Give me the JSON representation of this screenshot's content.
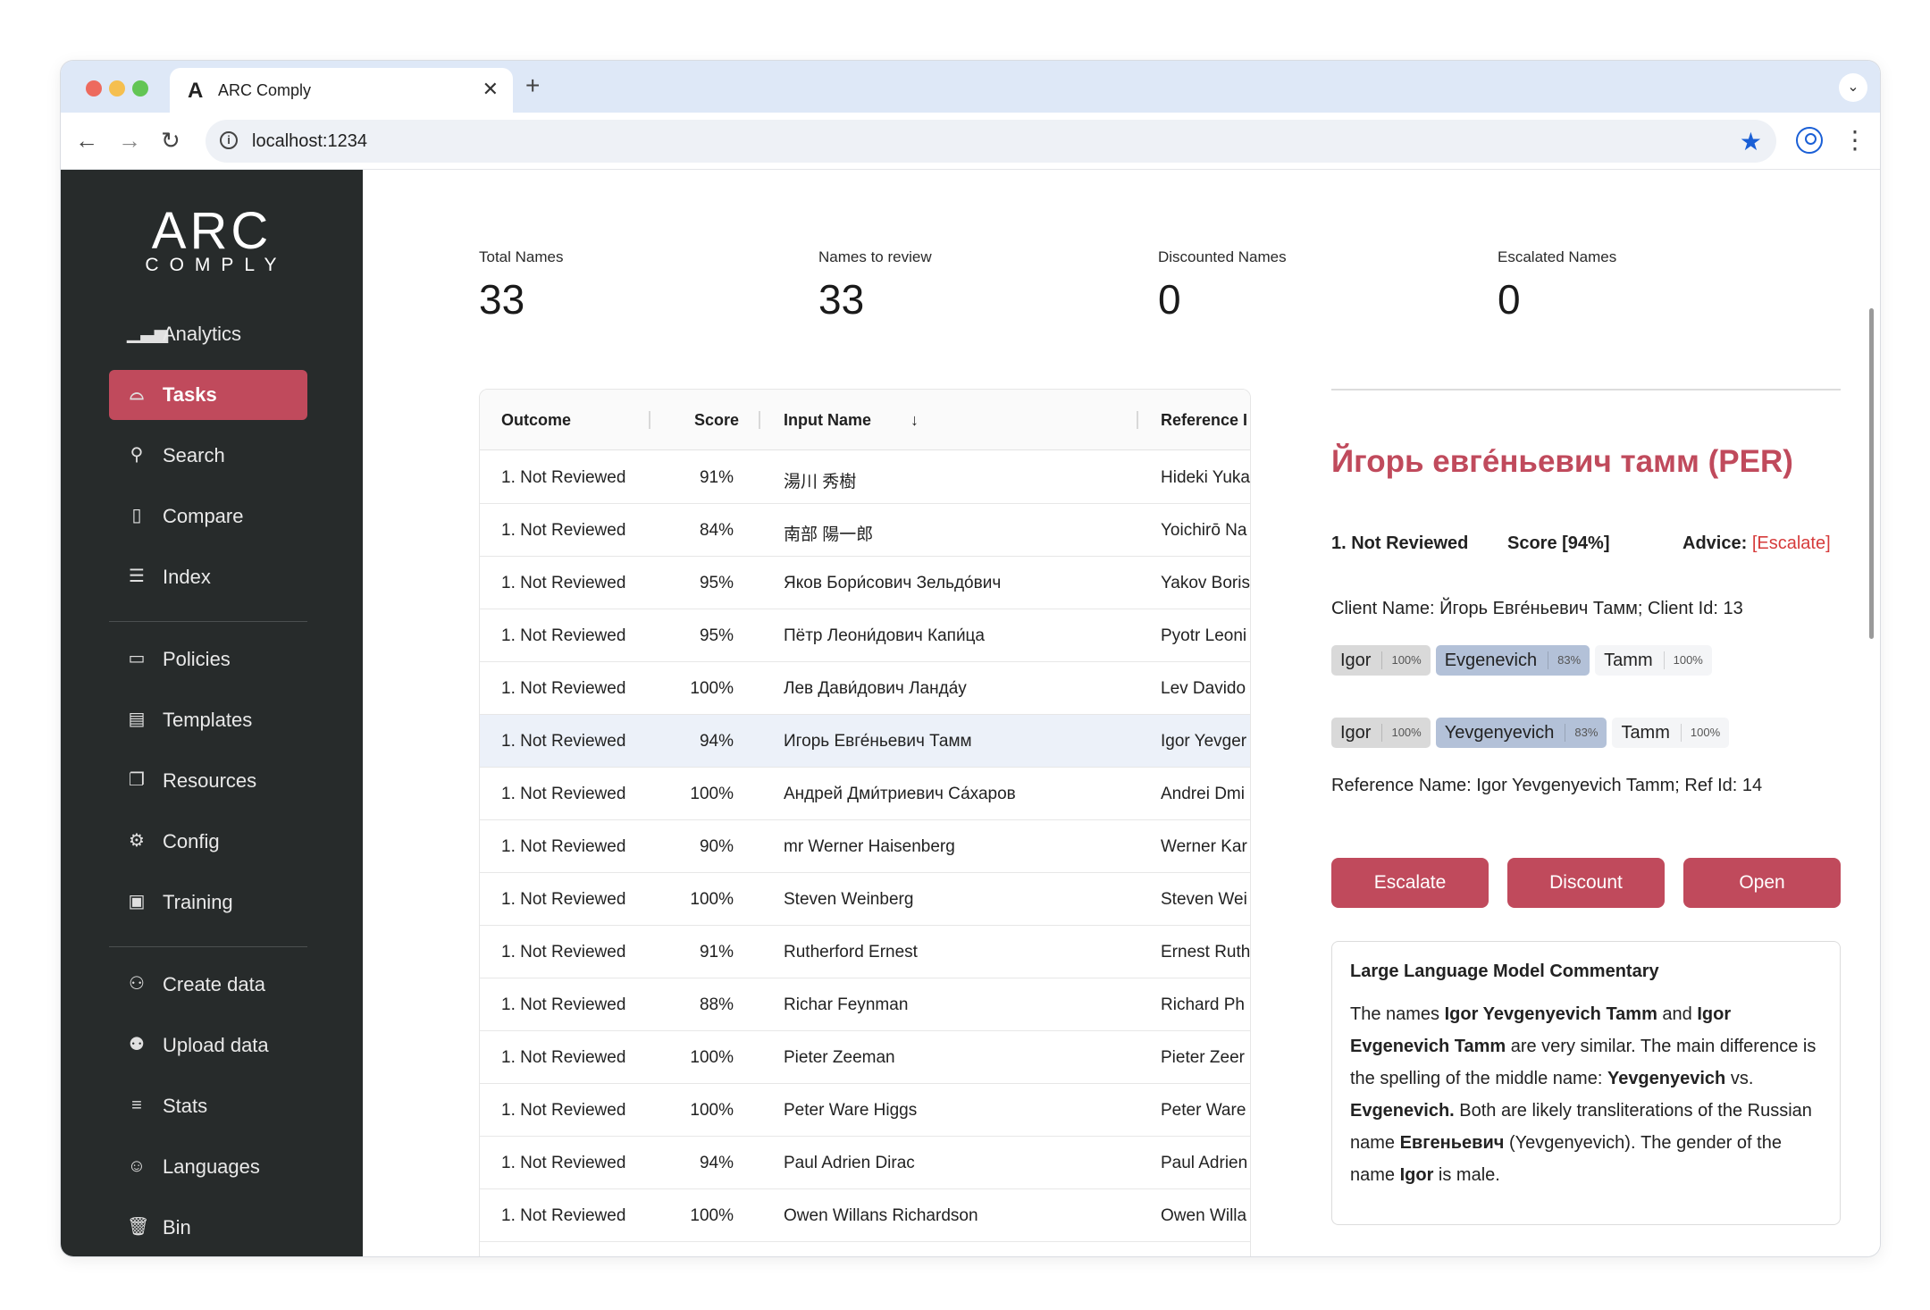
{
  "browser": {
    "tab_title": "ARC Comply",
    "tab_logo": "A",
    "url": "localhost:1234"
  },
  "sidebar": {
    "logo_main": "ARC",
    "logo_sub": "COMPLY",
    "items": [
      {
        "label": "Analytics",
        "icon": "bar-chart-icon"
      },
      {
        "label": "Tasks",
        "icon": "inbox-icon"
      },
      {
        "label": "Search",
        "icon": "search-icon"
      },
      {
        "label": "Compare",
        "icon": "clipboard-icon"
      },
      {
        "label": "Index",
        "icon": "list-index-icon"
      },
      {
        "label": "Policies",
        "icon": "document-icon"
      },
      {
        "label": "Templates",
        "icon": "file-text-icon"
      },
      {
        "label": "Resources",
        "icon": "copy-icon"
      },
      {
        "label": "Config",
        "icon": "gear-icon"
      },
      {
        "label": "Training",
        "icon": "chip-icon"
      },
      {
        "label": "Create data",
        "icon": "users-icon"
      },
      {
        "label": "Upload data",
        "icon": "user-upload-icon"
      },
      {
        "label": "Stats",
        "icon": "database-icon"
      },
      {
        "label": "Languages",
        "icon": "robot-icon"
      },
      {
        "label": "Bin",
        "icon": "trash-icon"
      }
    ]
  },
  "stats": [
    {
      "label": "Total Names",
      "value": "33"
    },
    {
      "label": "Names to review",
      "value": "33"
    },
    {
      "label": "Discounted Names",
      "value": "0"
    },
    {
      "label": "Escalated Names",
      "value": "0"
    }
  ],
  "table": {
    "headers": {
      "outcome": "Outcome",
      "score": "Score",
      "input": "Input Name",
      "ref": "Reference I",
      "sort_icon": "arrow-down-icon"
    },
    "rows": [
      {
        "outcome": "1. Not Reviewed",
        "score": "91%",
        "input": "湯川 秀樹",
        "ref": "Hideki Yuka"
      },
      {
        "outcome": "1. Not Reviewed",
        "score": "84%",
        "input": "南部 陽一郎",
        "ref": "Yoichirō Na"
      },
      {
        "outcome": "1. Not Reviewed",
        "score": "95%",
        "input": "Яков Бори́сович Зельдо́вич",
        "ref": "Yakov Boris"
      },
      {
        "outcome": "1. Not Reviewed",
        "score": "95%",
        "input": "Пётр Леони́дович Капи́ца",
        "ref": "Pyotr Leoni"
      },
      {
        "outcome": "1. Not Reviewed",
        "score": "100%",
        "input": "Лев Дави́дович Ланда́у",
        "ref": "Lev Davido"
      },
      {
        "outcome": "1. Not Reviewed",
        "score": "94%",
        "input": "Игорь Евге́ньевич Тамм",
        "ref": "Igor Yevger"
      },
      {
        "outcome": "1. Not Reviewed",
        "score": "100%",
        "input": "Андрей Дми́триевич Са́харов",
        "ref": "Andrei Dmi"
      },
      {
        "outcome": "1. Not Reviewed",
        "score": "90%",
        "input": "mr Werner Haisenberg",
        "ref": "Werner Kar"
      },
      {
        "outcome": "1. Not Reviewed",
        "score": "100%",
        "input": "Steven Weinberg",
        "ref": "Steven Wei"
      },
      {
        "outcome": "1. Not Reviewed",
        "score": "91%",
        "input": "Rutherford Ernest",
        "ref": "Ernest Ruth"
      },
      {
        "outcome": "1. Not Reviewed",
        "score": "88%",
        "input": "Richar Feynman",
        "ref": "Richard Ph"
      },
      {
        "outcome": "1. Not Reviewed",
        "score": "100%",
        "input": "Pieter Zeeman",
        "ref": "Pieter Zeer"
      },
      {
        "outcome": "1. Not Reviewed",
        "score": "100%",
        "input": "Peter Ware Higgs",
        "ref": "Peter Ware"
      },
      {
        "outcome": "1. Not Reviewed",
        "score": "94%",
        "input": "Paul Adrien Dirac",
        "ref": "Paul Adrien"
      },
      {
        "outcome": "1. Not Reviewed",
        "score": "100%",
        "input": "Owen Willans Richardson",
        "ref": "Owen Willa"
      }
    ]
  },
  "detail": {
    "title": "Йгорь евге́ньевич тамм (PER)",
    "status": "1. Not Reviewed",
    "score": "Score [94%]",
    "advice_label": "Advice:",
    "advice_value": "[Escalate]",
    "client_line": "Client Name: Йгорь Евге́ньевич Тамм; Client Id: 13",
    "client_tokens": [
      {
        "name": "Igor",
        "pct": "100%"
      },
      {
        "name": "Evgenevich",
        "pct": "83%"
      },
      {
        "name": "Tamm",
        "pct": "100%"
      }
    ],
    "ref_tokens": [
      {
        "name": "Igor",
        "pct": "100%"
      },
      {
        "name": "Yevgenyevich",
        "pct": "83%"
      },
      {
        "name": "Tamm",
        "pct": "100%"
      }
    ],
    "ref_line": "Reference Name: Igor Yevgenyevich Tamm; Ref Id: 14",
    "buttons": {
      "escalate": "Escalate",
      "discount": "Discount",
      "open": "Open"
    },
    "commentary": {
      "title": "Large Language Model Commentary",
      "t1": "The names ",
      "b1": "Igor Yevgenyevich Tamm",
      "t2": " and ",
      "b2": "Igor Evgenevich Tamm",
      "t3": " are very similar. The main difference is the spelling of the middle name: ",
      "b3": "Yevgenyevich",
      "t4": " vs. ",
      "b4": "Evgenevich.",
      "t5": " Both are likely transliterations of the Russian name ",
      "b5": "Евгеньевич",
      "t6": " (Yevgenyevich). The gender of the name ",
      "b6": "Igor",
      "t7": " is male."
    }
  },
  "colors": {
    "accent": "#c04a5c",
    "sidebar_bg": "#272b2b",
    "selected_row": "#ecf1f9",
    "advice": "#d63b3b"
  }
}
